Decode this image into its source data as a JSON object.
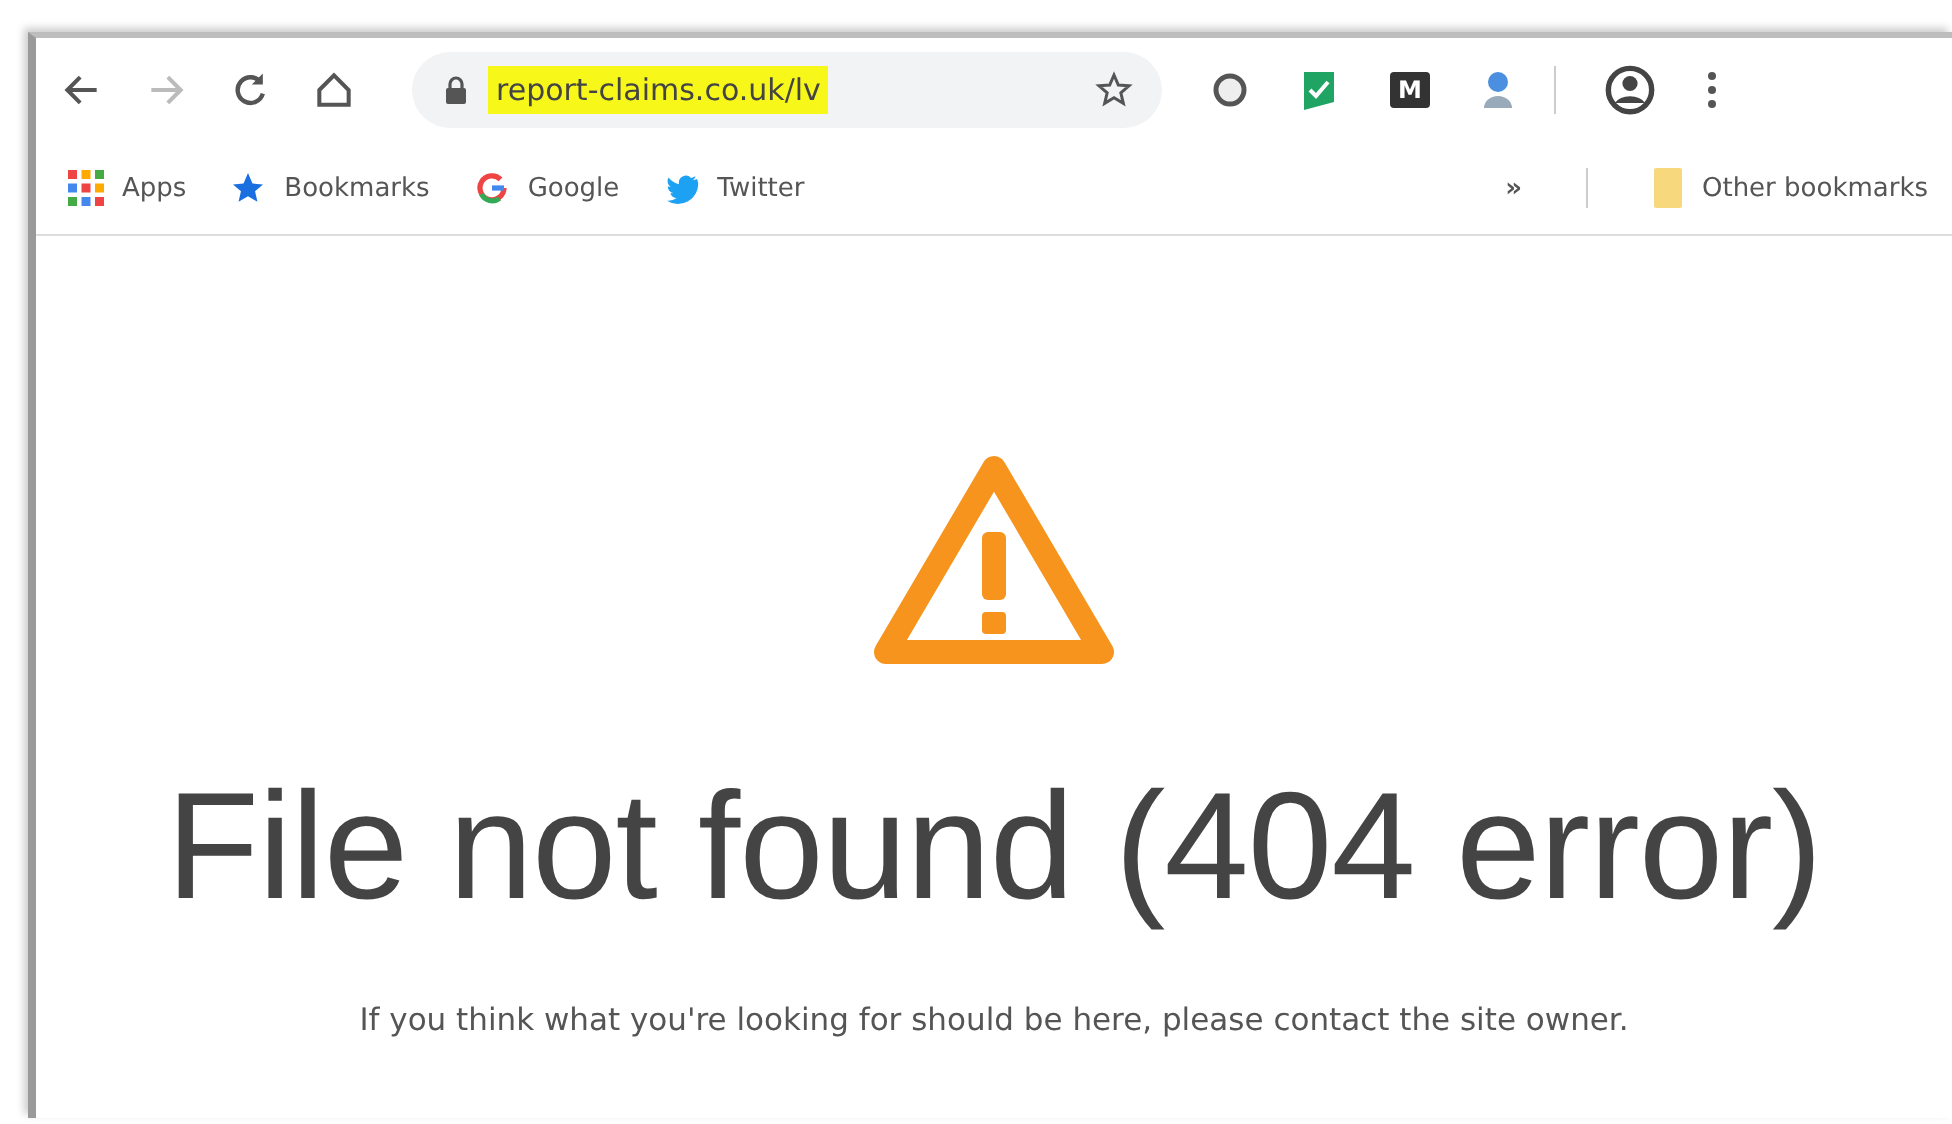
{
  "toolbar": {
    "url": "report-claims.co.uk/lv",
    "url_highlighted": true,
    "forward_disabled": true,
    "extension_letter": "M"
  },
  "bookmarks": [
    {
      "label": "Apps",
      "kind": "apps"
    },
    {
      "label": "Bookmarks",
      "kind": "star"
    },
    {
      "label": "Google",
      "kind": "google"
    },
    {
      "label": "Twitter",
      "kind": "twitter"
    }
  ],
  "overflow": "»",
  "other_bookmarks": "Other bookmarks",
  "error": {
    "title": "File not found (404 error)",
    "message": "If you think what you're looking for should be here, please contact the site owner."
  }
}
